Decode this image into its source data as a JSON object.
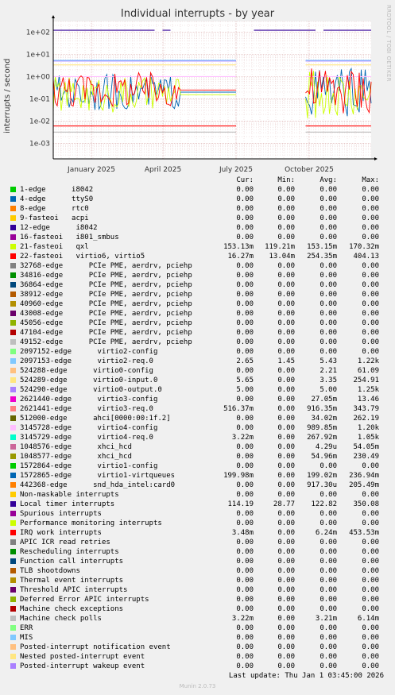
{
  "chart_data": {
    "type": "line",
    "title": "Individual interrupts - by year",
    "ylabel": "interrupts / second",
    "yscale": "log",
    "ylim": [
      0.0002,
      300
    ],
    "y_ticks": [
      "1e+02",
      "1e+01",
      "1e+00",
      "1e-01",
      "1e-02",
      "1e-03"
    ],
    "x_ticks": [
      "January 2025",
      "April 2025",
      "July 2025",
      "October 2025"
    ],
    "side_label": "RRDTOOL / TOBI OETIKER",
    "grid": true,
    "columns": [
      "Cur:",
      "Min:",
      "Avg:",
      "Max:"
    ],
    "series": [
      {
        "name": "1-edge      i8042",
        "color": "#00cc00",
        "cur": "0.00",
        "min": "0.00",
        "avg": "0.00",
        "max": "0.00"
      },
      {
        "name": "4-edge      ttyS0",
        "color": "#0066b3",
        "cur": "0.00",
        "min": "0.00",
        "avg": "0.00",
        "max": "0.00"
      },
      {
        "name": "8-edge      rtc0",
        "color": "#ff8000",
        "cur": "0.00",
        "min": "0.00",
        "avg": "0.00",
        "max": "0.00"
      },
      {
        "name": "9-fasteoi   acpi",
        "color": "#ffcc00",
        "cur": "0.00",
        "min": "0.00",
        "avg": "0.00",
        "max": "0.00"
      },
      {
        "name": "12-edge      i8042",
        "color": "#330099",
        "cur": "0.00",
        "min": "0.00",
        "avg": "0.00",
        "max": "0.00"
      },
      {
        "name": "16-fasteoi   i801_smbus",
        "color": "#990099",
        "cur": "0.00",
        "min": "0.00",
        "avg": "0.00",
        "max": "0.00"
      },
      {
        "name": "21-fasteoi   qxl",
        "color": "#ccff00",
        "cur": "153.13m",
        "min": "119.21m",
        "avg": "153.15m",
        "max": "170.32m"
      },
      {
        "name": "22-fasteoi   virtio6, virtio5",
        "color": "#ff0000",
        "cur": "16.27m",
        "min": "13.04m",
        "avg": "254.35m",
        "max": "404.13"
      },
      {
        "name": "32768-edge      PCIe PME, aerdrv, pciehp",
        "color": "#808080",
        "cur": "0.00",
        "min": "0.00",
        "avg": "0.00",
        "max": "0.00"
      },
      {
        "name": "34816-edge      PCIe PME, aerdrv, pciehp",
        "color": "#008f00",
        "cur": "0.00",
        "min": "0.00",
        "avg": "0.00",
        "max": "0.00"
      },
      {
        "name": "36864-edge      PCIe PME, aerdrv, pciehp",
        "color": "#00487d",
        "cur": "0.00",
        "min": "0.00",
        "avg": "0.00",
        "max": "0.00"
      },
      {
        "name": "38912-edge      PCIe PME, aerdrv, pciehp",
        "color": "#b35a00",
        "cur": "0.00",
        "min": "0.00",
        "avg": "0.00",
        "max": "0.00"
      },
      {
        "name": "40960-edge      PCIe PME, aerdrv, pciehp",
        "color": "#b38f00",
        "cur": "0.00",
        "min": "0.00",
        "avg": "0.00",
        "max": "0.00"
      },
      {
        "name": "43008-edge      PCIe PME, aerdrv, pciehp",
        "color": "#6b006b",
        "cur": "0.00",
        "min": "0.00",
        "avg": "0.00",
        "max": "0.00"
      },
      {
        "name": "45056-edge      PCIe PME, aerdrv, pciehp",
        "color": "#8fb300",
        "cur": "0.00",
        "min": "0.00",
        "avg": "0.00",
        "max": "0.00"
      },
      {
        "name": "47104-edge      PCIe PME, aerdrv, pciehp",
        "color": "#b30000",
        "cur": "0.00",
        "min": "0.00",
        "avg": "0.00",
        "max": "0.00"
      },
      {
        "name": "49152-edge      PCIe PME, aerdrv, pciehp",
        "color": "#bebebe",
        "cur": "0.00",
        "min": "0.00",
        "avg": "0.00",
        "max": "0.00"
      },
      {
        "name": "2097152-edge      virtio2-config",
        "color": "#80ff80",
        "cur": "0.00",
        "min": "0.00",
        "avg": "0.00",
        "max": "0.00"
      },
      {
        "name": "2097153-edge      virtio2-req.0",
        "color": "#80c9ff",
        "cur": "2.65",
        "min": "1.45",
        "avg": "5.43",
        "max": "1.22k"
      },
      {
        "name": "524288-edge      virtio0-config",
        "color": "#ffc080",
        "cur": "0.00",
        "min": "0.00",
        "avg": "2.21",
        "max": "61.09"
      },
      {
        "name": "524289-edge      virtio0-input.0",
        "color": "#ffe680",
        "cur": "5.65",
        "min": "0.00",
        "avg": "3.35",
        "max": "254.91"
      },
      {
        "name": "524290-edge      virtio0-output.0",
        "color": "#aa80ff",
        "cur": "5.00",
        "min": "0.00",
        "avg": "5.00",
        "max": "1.25k"
      },
      {
        "name": "2621440-edge      virtio3-config",
        "color": "#ee00cc",
        "cur": "0.00",
        "min": "0.00",
        "avg": "27.05m",
        "max": "13.46"
      },
      {
        "name": "2621441-edge      virtio3-req.0",
        "color": "#ff8080",
        "cur": "516.37m",
        "min": "0.00",
        "avg": "916.35m",
        "max": "343.79"
      },
      {
        "name": "512000-edge      ahci[0000:00:1f.2]",
        "color": "#666600",
        "cur": "0.00",
        "min": "0.00",
        "avg": "34.02m",
        "max": "262.19"
      },
      {
        "name": "3145728-edge      virtio4-config",
        "color": "#ffbfff",
        "cur": "0.00",
        "min": "0.00",
        "avg": "989.85m",
        "max": "1.20k"
      },
      {
        "name": "3145729-edge      virtio4-req.0",
        "color": "#00ffcc",
        "cur": "3.22m",
        "min": "0.00",
        "avg": "267.92m",
        "max": "1.05k"
      },
      {
        "name": "1048576-edge      xhci_hcd",
        "color": "#cc6699",
        "cur": "0.00",
        "min": "0.00",
        "avg": "4.29u",
        "max": "54.05m"
      },
      {
        "name": "1048577-edge      xhci_hcd",
        "color": "#999900",
        "cur": "0.00",
        "min": "0.00",
        "avg": "54.96m",
        "max": "230.49"
      },
      {
        "name": "1572864-edge      virtio1-config",
        "color": "#00cc00",
        "cur": "0.00",
        "min": "0.00",
        "avg": "0.00",
        "max": "0.00"
      },
      {
        "name": "1572865-edge      virtio1-virtqueues",
        "color": "#0066b3",
        "cur": "199.98m",
        "min": "0.00",
        "avg": "199.02m",
        "max": "236.94m"
      },
      {
        "name": "442368-edge      snd_hda_intel:card0",
        "color": "#ff8000",
        "cur": "0.00",
        "min": "0.00",
        "avg": "917.30u",
        "max": "205.49m"
      },
      {
        "name": "Non-maskable interrupts",
        "color": "#ffcc00",
        "cur": "0.00",
        "min": "0.00",
        "avg": "0.00",
        "max": "0.00"
      },
      {
        "name": "Local timer interrupts",
        "color": "#330099",
        "cur": "114.19",
        "min": "28.77",
        "avg": "122.82",
        "max": "350.08"
      },
      {
        "name": "Spurious interrupts",
        "color": "#990099",
        "cur": "0.00",
        "min": "0.00",
        "avg": "0.00",
        "max": "0.00"
      },
      {
        "name": "Performance monitoring interrupts",
        "color": "#ccff00",
        "cur": "0.00",
        "min": "0.00",
        "avg": "0.00",
        "max": "0.00"
      },
      {
        "name": "IRQ work interrupts",
        "color": "#ff0000",
        "cur": "3.48m",
        "min": "0.00",
        "avg": "6.24m",
        "max": "453.53m"
      },
      {
        "name": "APIC ICR read retries",
        "color": "#808080",
        "cur": "0.00",
        "min": "0.00",
        "avg": "0.00",
        "max": "0.00"
      },
      {
        "name": "Rescheduling interrupts",
        "color": "#008f00",
        "cur": "0.00",
        "min": "0.00",
        "avg": "0.00",
        "max": "0.00"
      },
      {
        "name": "Function call interrupts",
        "color": "#00487d",
        "cur": "0.00",
        "min": "0.00",
        "avg": "0.00",
        "max": "0.00"
      },
      {
        "name": "TLB shootdowns",
        "color": "#b35a00",
        "cur": "0.00",
        "min": "0.00",
        "avg": "0.00",
        "max": "0.00"
      },
      {
        "name": "Thermal event interrupts",
        "color": "#b38f00",
        "cur": "0.00",
        "min": "0.00",
        "avg": "0.00",
        "max": "0.00"
      },
      {
        "name": "Threshold APIC interrupts",
        "color": "#6b006b",
        "cur": "0.00",
        "min": "0.00",
        "avg": "0.00",
        "max": "0.00"
      },
      {
        "name": "Deferred Error APIC interrupts",
        "color": "#8fb300",
        "cur": "0.00",
        "min": "0.00",
        "avg": "0.00",
        "max": "0.00"
      },
      {
        "name": "Machine check exceptions",
        "color": "#b30000",
        "cur": "0.00",
        "min": "0.00",
        "avg": "0.00",
        "max": "0.00"
      },
      {
        "name": "Machine check polls",
        "color": "#bebebe",
        "cur": "3.22m",
        "min": "0.00",
        "avg": "3.21m",
        "max": "6.14m"
      },
      {
        "name": "ERR",
        "color": "#80ff80",
        "cur": "0.00",
        "min": "0.00",
        "avg": "0.00",
        "max": "0.00"
      },
      {
        "name": "MIS",
        "color": "#80c9ff",
        "cur": "0.00",
        "min": "0.00",
        "avg": "0.00",
        "max": "0.00"
      },
      {
        "name": "Posted-interrupt notification event",
        "color": "#ffc080",
        "cur": "0.00",
        "min": "0.00",
        "avg": "0.00",
        "max": "0.00"
      },
      {
        "name": "Nested posted-interrupt event",
        "color": "#ffe680",
        "cur": "0.00",
        "min": "0.00",
        "avg": "0.00",
        "max": "0.00"
      },
      {
        "name": "Posted-interrupt wakeup event",
        "color": "#aa80ff",
        "cur": "0.00",
        "min": "0.00",
        "avg": "0.00",
        "max": "0.00"
      }
    ],
    "plotted_traces": [
      {
        "name": "Local timer interrupts",
        "color": "#330099",
        "level": 120,
        "gaps": [
          [
            0.32,
            0.34
          ],
          [
            0.37,
            0.63
          ],
          [
            0.83,
            0.85
          ]
        ]
      },
      {
        "name": "524290-edge      virtio0-output.0",
        "color": "#aa80ff",
        "level": 5.0
      },
      {
        "name": "524289-edge      virtio0-input.0",
        "color": "#ffe680",
        "level": 3.35
      },
      {
        "name": "2097153-edge      virtio2-req.0",
        "color": "#80c9ff",
        "level": 5.4
      },
      {
        "name": "1572865-edge      virtio1-virtqueues",
        "color": "#0066b3",
        "level": 0.2
      },
      {
        "name": "21-fasteoi   qxl",
        "color": "#ccff00",
        "level": 0.153
      },
      {
        "name": "3145728-edge      virtio4-config",
        "color": "#ffbfff",
        "level": 1.0
      },
      {
        "name": "22-fasteoi   virtio6, virtio5",
        "color": "#ff0000",
        "level": 0.25
      },
      {
        "name": "IRQ work interrupts",
        "color": "#ff0000",
        "level": 0.006
      },
      {
        "name": "Machine check polls",
        "color": "#bebebe",
        "level": 0.0032
      }
    ]
  },
  "footer": {
    "last_update": "Last update: Thu Jan  1 03:45:00 2026",
    "version": "Munin 2.0.73"
  }
}
